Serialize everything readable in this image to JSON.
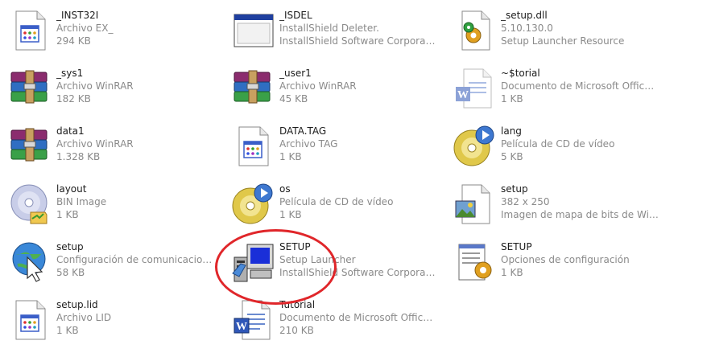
{
  "files": [
    {
      "name": "_INST32I",
      "type": "Archivo EX_",
      "size": "294 KB",
      "icon": "generic-app-file-icon"
    },
    {
      "name": "_ISDEL",
      "type": "InstallShield Deleter.",
      "size": "InstallShield Software Corpora…",
      "icon": "window-app-icon"
    },
    {
      "name": "_setup.dll",
      "type": "5.10.130.0",
      "size": "Setup Launcher Resource",
      "icon": "dll-gear-icon"
    },
    {
      "name": "_sys1",
      "type": "Archivo WinRAR",
      "size": "182 KB",
      "icon": "winrar-archive-icon"
    },
    {
      "name": "_user1",
      "type": "Archivo WinRAR",
      "size": "45 KB",
      "icon": "winrar-archive-icon"
    },
    {
      "name": "~$torial",
      "type": "Documento de Microsoft Offic…",
      "size": "1 KB",
      "icon": "word-document-faded-icon"
    },
    {
      "name": "data1",
      "type": "Archivo WinRAR",
      "size": "1.328 KB",
      "icon": "winrar-archive-icon"
    },
    {
      "name": "DATA.TAG",
      "type": "Archivo TAG",
      "size": "1 KB",
      "icon": "generic-app-file-icon"
    },
    {
      "name": "lang",
      "type": "Película de CD de vídeo",
      "size": "5 KB",
      "icon": "video-cd-icon"
    },
    {
      "name": "layout",
      "type": "BIN Image",
      "size": "1 KB",
      "icon": "bin-image-disc-icon"
    },
    {
      "name": "os",
      "type": "Película de CD de vídeo",
      "size": "1 KB",
      "icon": "video-cd-icon"
    },
    {
      "name": "setup",
      "type": "382 x 250",
      "size": "Imagen de mapa de bits de Wi…",
      "icon": "bitmap-image-icon"
    },
    {
      "name": "setup",
      "type": "Configuración de comunicacio…",
      "size": "58 KB",
      "icon": "globe-cursor-icon"
    },
    {
      "name": "SETUP",
      "type": "Setup Launcher",
      "size": "InstallShield Software Corpora…",
      "icon": "setup-launcher-computer-icon"
    },
    {
      "name": "SETUP",
      "type": "Opciones de configuración",
      "size": "1 KB",
      "icon": "config-notepad-gear-icon"
    },
    {
      "name": "setup.lid",
      "type": "Archivo LID",
      "size": "1 KB",
      "icon": "generic-app-file-icon"
    },
    {
      "name": "Tutorial",
      "type": "Documento de Microsoft Offic…",
      "size": "210 KB",
      "icon": "word-document-icon"
    }
  ],
  "colors": {
    "highlight": "#e0262a",
    "name_text": "#1c1c1c",
    "secondary_text": "#8a8a8a"
  }
}
